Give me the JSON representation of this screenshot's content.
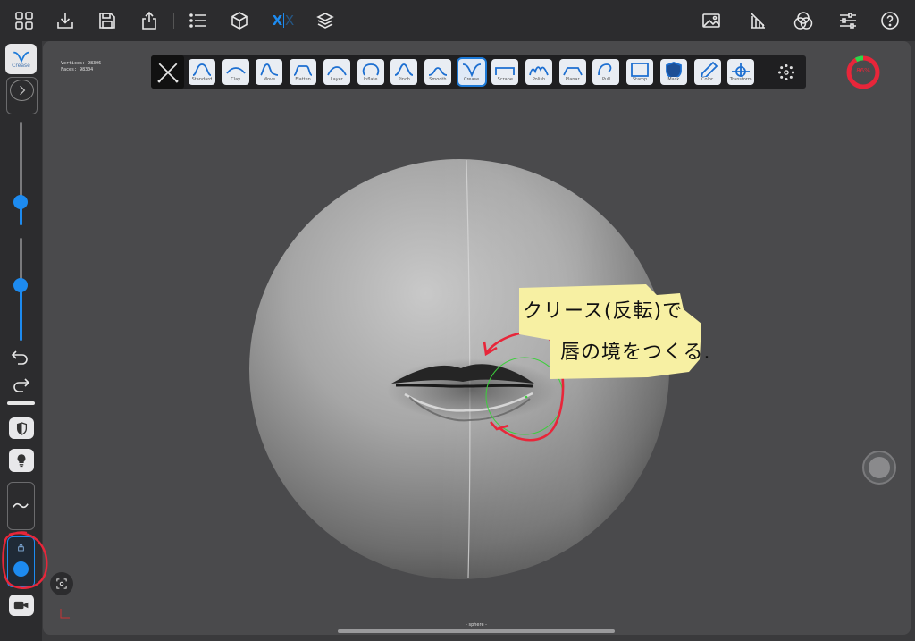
{
  "app": {
    "accent": "#1d8bf0"
  },
  "topbar": {
    "icons": [
      "grid-icon",
      "import-icon",
      "save-icon",
      "share-icon",
      "list-icon",
      "cube-icon",
      "symmetry-x-icon",
      "layers-icon",
      "image-icon",
      "shading-icon",
      "color-circles-icon",
      "sliders-icon",
      "help-icon"
    ],
    "symmetry_label": "X"
  },
  "stats": {
    "vertices": "Vertices: 98306",
    "faces": "Faces:    98304"
  },
  "tools": [
    {
      "label": "Standard"
    },
    {
      "label": "Clay"
    },
    {
      "label": "Move"
    },
    {
      "label": "Flatten"
    },
    {
      "label": "Layer"
    },
    {
      "label": "Inflate"
    },
    {
      "label": "Pinch"
    },
    {
      "label": "Smooth"
    },
    {
      "label": "Crease"
    },
    {
      "label": "Scrape"
    },
    {
      "label": "Polish"
    },
    {
      "label": "Planar"
    },
    {
      "label": "Pull"
    },
    {
      "label": "Stamp"
    },
    {
      "label": "Mask"
    },
    {
      "label": "Color"
    },
    {
      "label": "Transform"
    }
  ],
  "active_tool": "Crease",
  "current_tool_label": "Crease",
  "memory_percent_label": "86%",
  "sliders": {
    "radius_fraction": 0.62,
    "intensity_fraction": 0.55
  },
  "object_name": "- sphere -",
  "annotation": {
    "line1": "クリース(反転)で",
    "line2": "唇の境をつくる."
  }
}
